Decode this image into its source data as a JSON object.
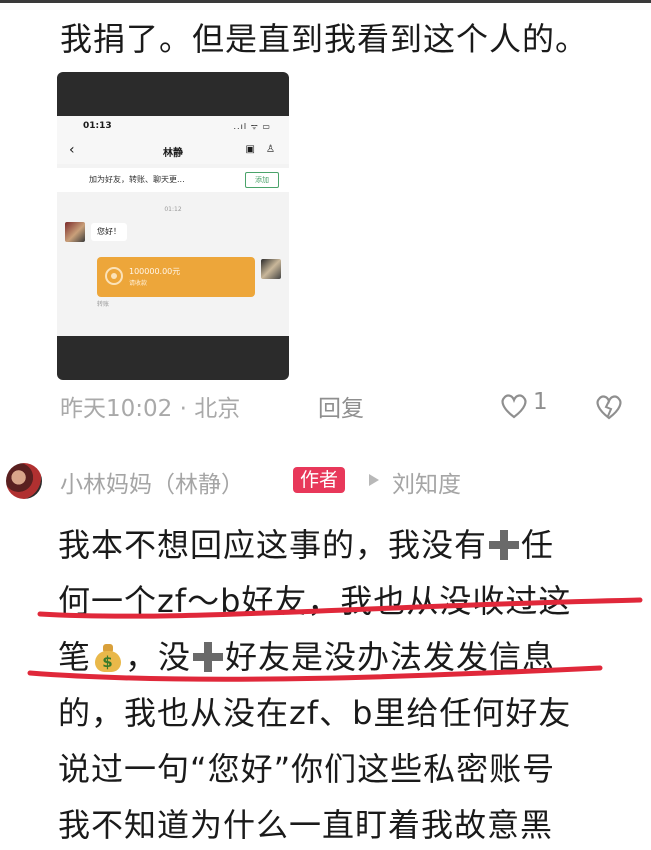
{
  "comment1": {
    "text": "我捐了。但是直到我看到这个人的。",
    "screenshot": {
      "time": "01:13",
      "signal": "..ıl ᯤ ▭",
      "chat_title": "林静",
      "banner_text": "加为好友，转账、聊天更...",
      "add_button": "添加",
      "timestamp": "01:12",
      "hello_message": "您好！",
      "transfer_amount": "100000.00元",
      "transfer_status": "请收款",
      "transfer_label": "转账"
    },
    "meta": "昨天10:02 · 北京",
    "reply_label": "回复",
    "like_count": "1"
  },
  "comment2": {
    "username": "小林妈妈（林静）",
    "author_badge": "作者",
    "reply_target": "刘知度",
    "lines": [
      "我本不想回应这事的，我没有",
      "任",
      "何一个zf～b好友，我也从没收过这",
      "笔",
      "，没",
      "好友是没办法发发信息",
      "的，我也从没在zf、b里给任何好友",
      "说过一句“您好”你们这些私密账号",
      "我不知道为什么一直盯着我故意黑"
    ]
  },
  "colors": {
    "badge": "#e8385a",
    "underline": "#e0283a",
    "transfer": "#eda63a"
  }
}
